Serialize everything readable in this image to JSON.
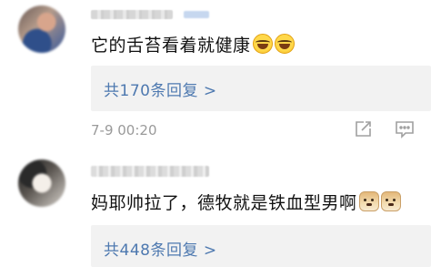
{
  "comments": [
    {
      "text": "它的舌苔看着就健康",
      "emojis": [
        "laughing-tears-icon",
        "laughing-tears-icon"
      ],
      "reply_summary": "共170条回复 >",
      "timestamp": "7-9 00:20",
      "actions": [
        "share-icon",
        "comment-icon"
      ]
    },
    {
      "text": "妈耶帅拉了，德牧就是铁血型男啊",
      "emojis": [
        "doge-icon",
        "doge-icon"
      ],
      "reply_summary": "共448条回复 >"
    }
  ],
  "colors": {
    "reply_link": "#4e79b0",
    "reply_bg": "#f2f2f2",
    "timestamp": "#9a9a9a",
    "text": "#111111"
  }
}
